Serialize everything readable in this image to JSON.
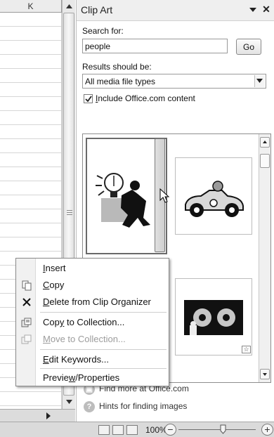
{
  "sheet": {
    "column_header": "K"
  },
  "pane": {
    "title": "Clip Art",
    "search_label": "Search for:",
    "search_value": "people",
    "go_label": "Go",
    "results_label": "Results should be:",
    "media_type_value": "All media file types",
    "include_label_pre": "I",
    "include_label_rest": "nclude Office.com content",
    "include_checked": true,
    "find_more": "Find more at Office.com",
    "hints": "Hints for finding images"
  },
  "context_menu": {
    "items": [
      {
        "pre": "",
        "key": "I",
        "post": "nsert",
        "enabled": true,
        "icon": ""
      },
      {
        "pre": "",
        "key": "C",
        "post": "opy",
        "enabled": true,
        "icon": "copy-icon"
      },
      {
        "pre": "",
        "key": "D",
        "post": "elete from Clip Organizer",
        "enabled": true,
        "icon": "delete-x-icon"
      },
      {
        "pre": "Cop",
        "key": "y",
        "post": " to Collection...",
        "enabled": true,
        "icon": "copy-to-collection-icon"
      },
      {
        "pre": "",
        "key": "M",
        "post": "ove to Collection...",
        "enabled": false,
        "icon": "move-to-collection-icon"
      },
      {
        "pre": "",
        "key": "E",
        "post": "dit Keywords...",
        "enabled": true,
        "icon": ""
      },
      {
        "pre": "Previe",
        "key": "w",
        "post": "/Properties",
        "enabled": true,
        "icon": ""
      }
    ]
  },
  "status": {
    "zoom": "100%"
  }
}
